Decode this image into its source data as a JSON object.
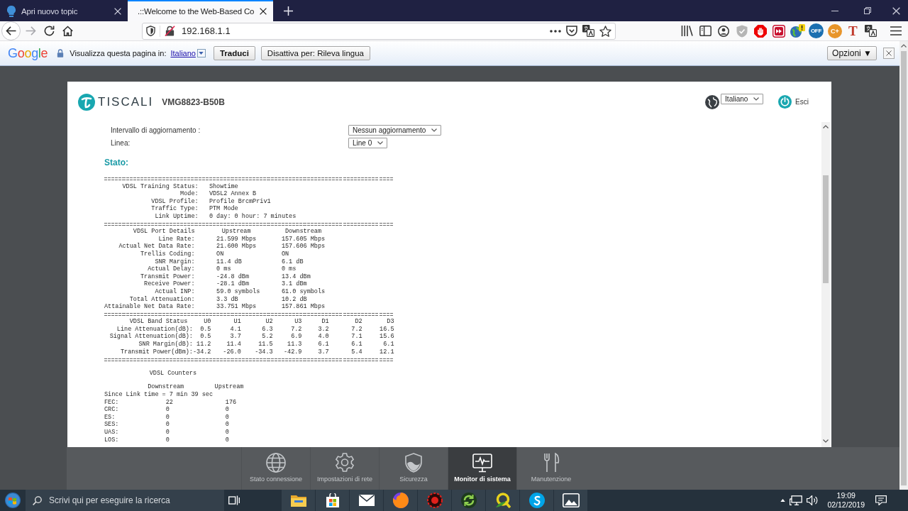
{
  "browser": {
    "tabs": [
      {
        "title": "Apri nuovo topic",
        "selected": false
      },
      {
        "title": ".::Welcome to the Web-Based Co",
        "selected": true
      }
    ],
    "address": "192.168.1.1",
    "extension_labels": [
      "OFF",
      "C+",
      "T"
    ]
  },
  "translate_bar": {
    "logo": "Google",
    "prompt": "Visualizza questa pagina in:",
    "language": "Italiano",
    "translate_button": "Traduci",
    "disable_button": "Disattiva per: Rileva lingua",
    "options_button": "Opzioni ▼"
  },
  "router": {
    "brand": "TISCALI",
    "model": "VMG8823-B50B",
    "language": "Italiano",
    "logout": "Esci",
    "settings": [
      {
        "label": "Intervallo di aggiornamento :",
        "value": "Nessun aggiornamento"
      },
      {
        "label": "Linea:",
        "value": "Line 0"
      }
    ],
    "section_title": "Stato:",
    "training": [
      {
        "label": "VDSL Training Status:",
        "value": "Showtime"
      },
      {
        "label": "Mode:",
        "value": "VDSL2 Annex B"
      },
      {
        "label": "VDSL Profile:",
        "value": "Profile BrcmPriv1"
      },
      {
        "label": "Traffic Type:",
        "value": "PTM Mode"
      },
      {
        "label": "Link Uptime:",
        "value": "0 day: 0 hour: 7 minutes"
      }
    ],
    "port_details": {
      "columns": [
        "VDSL Port Details",
        "Upstream",
        "Downstream"
      ],
      "rows": [
        [
          "Line Rate:",
          "21.599 Mbps",
          "157.605 Mbps"
        ],
        [
          "Actual Net Data Rate:",
          "21.600 Mbps",
          "157.606 Mbps"
        ],
        [
          "Trellis Coding:",
          "ON",
          "ON"
        ],
        [
          "SNR Margin:",
          "11.4 dB",
          "6.1 dB"
        ],
        [
          "Actual Delay:",
          "0 ms",
          "0 ms"
        ],
        [
          "Transmit Power:",
          "-24.8 dBm",
          "13.4 dBm"
        ],
        [
          "Receive Power:",
          "-28.1 dBm",
          "3.1 dBm"
        ],
        [
          "Actual INP:",
          "59.0 symbols",
          "61.0 symbols"
        ],
        [
          "Total Attenuation:",
          "3.3 dB",
          "10.2 dB"
        ],
        [
          "Attainable Net Data Rate:",
          "33.751 Mbps",
          "157.861 Mbps"
        ]
      ]
    },
    "band_status": {
      "columns": [
        "VDSL Band Status",
        "U0",
        "U1",
        "U2",
        "U3",
        "D1",
        "D2",
        "D3"
      ],
      "rows": [
        [
          "Line Attenuation(dB):",
          "0.5",
          "4.1",
          "6.3",
          "7.2",
          "3.2",
          "7.2",
          "16.5"
        ],
        [
          "Signal Attenuation(dB):",
          "0.5",
          "3.7",
          "5.2",
          "6.9",
          "4.0",
          "7.1",
          "15.6"
        ],
        [
          "SNR Margin(dB):",
          "11.2",
          "11.4",
          "11.5",
          "11.3",
          "6.1",
          "6.1",
          "6.1"
        ],
        [
          "Transmit Power(dBm):",
          "-34.2",
          "-26.0",
          "-34.3",
          "-42.9",
          "3.7",
          "5.4",
          "12.1"
        ]
      ]
    },
    "counters": {
      "title": "VDSL Counters",
      "columns": [
        "Downstream",
        "Upstream"
      ],
      "since": "Since Link time = 7 min 39 sec",
      "rows": [
        {
          "label": "FEC:",
          "cells": [
            "22",
            "176"
          ]
        },
        {
          "label": "CRC:",
          "cells": [
            "0",
            "0"
          ]
        },
        {
          "label": "ES:",
          "cells": [
            "0",
            "0"
          ]
        },
        {
          "label": "SES:",
          "cells": [
            "0",
            "0"
          ]
        },
        {
          "label": "UAS:",
          "cells": [
            "0",
            "0"
          ]
        },
        {
          "label": "LOS:",
          "cells": [
            "0",
            "0"
          ]
        }
      ]
    }
  },
  "nav": [
    {
      "label": "Stato connessione",
      "selected": false
    },
    {
      "label": "Impostazioni di rete",
      "selected": false
    },
    {
      "label": "Sicurezza",
      "selected": false
    },
    {
      "label": "Monitor di sistema",
      "selected": true
    },
    {
      "label": "Manutenzione",
      "selected": false
    }
  ],
  "taskbar": {
    "search": {
      "placeholder": "Scrivi qui per eseguire la ricerca"
    },
    "time": "19:09",
    "date": "02/12/2019"
  }
}
